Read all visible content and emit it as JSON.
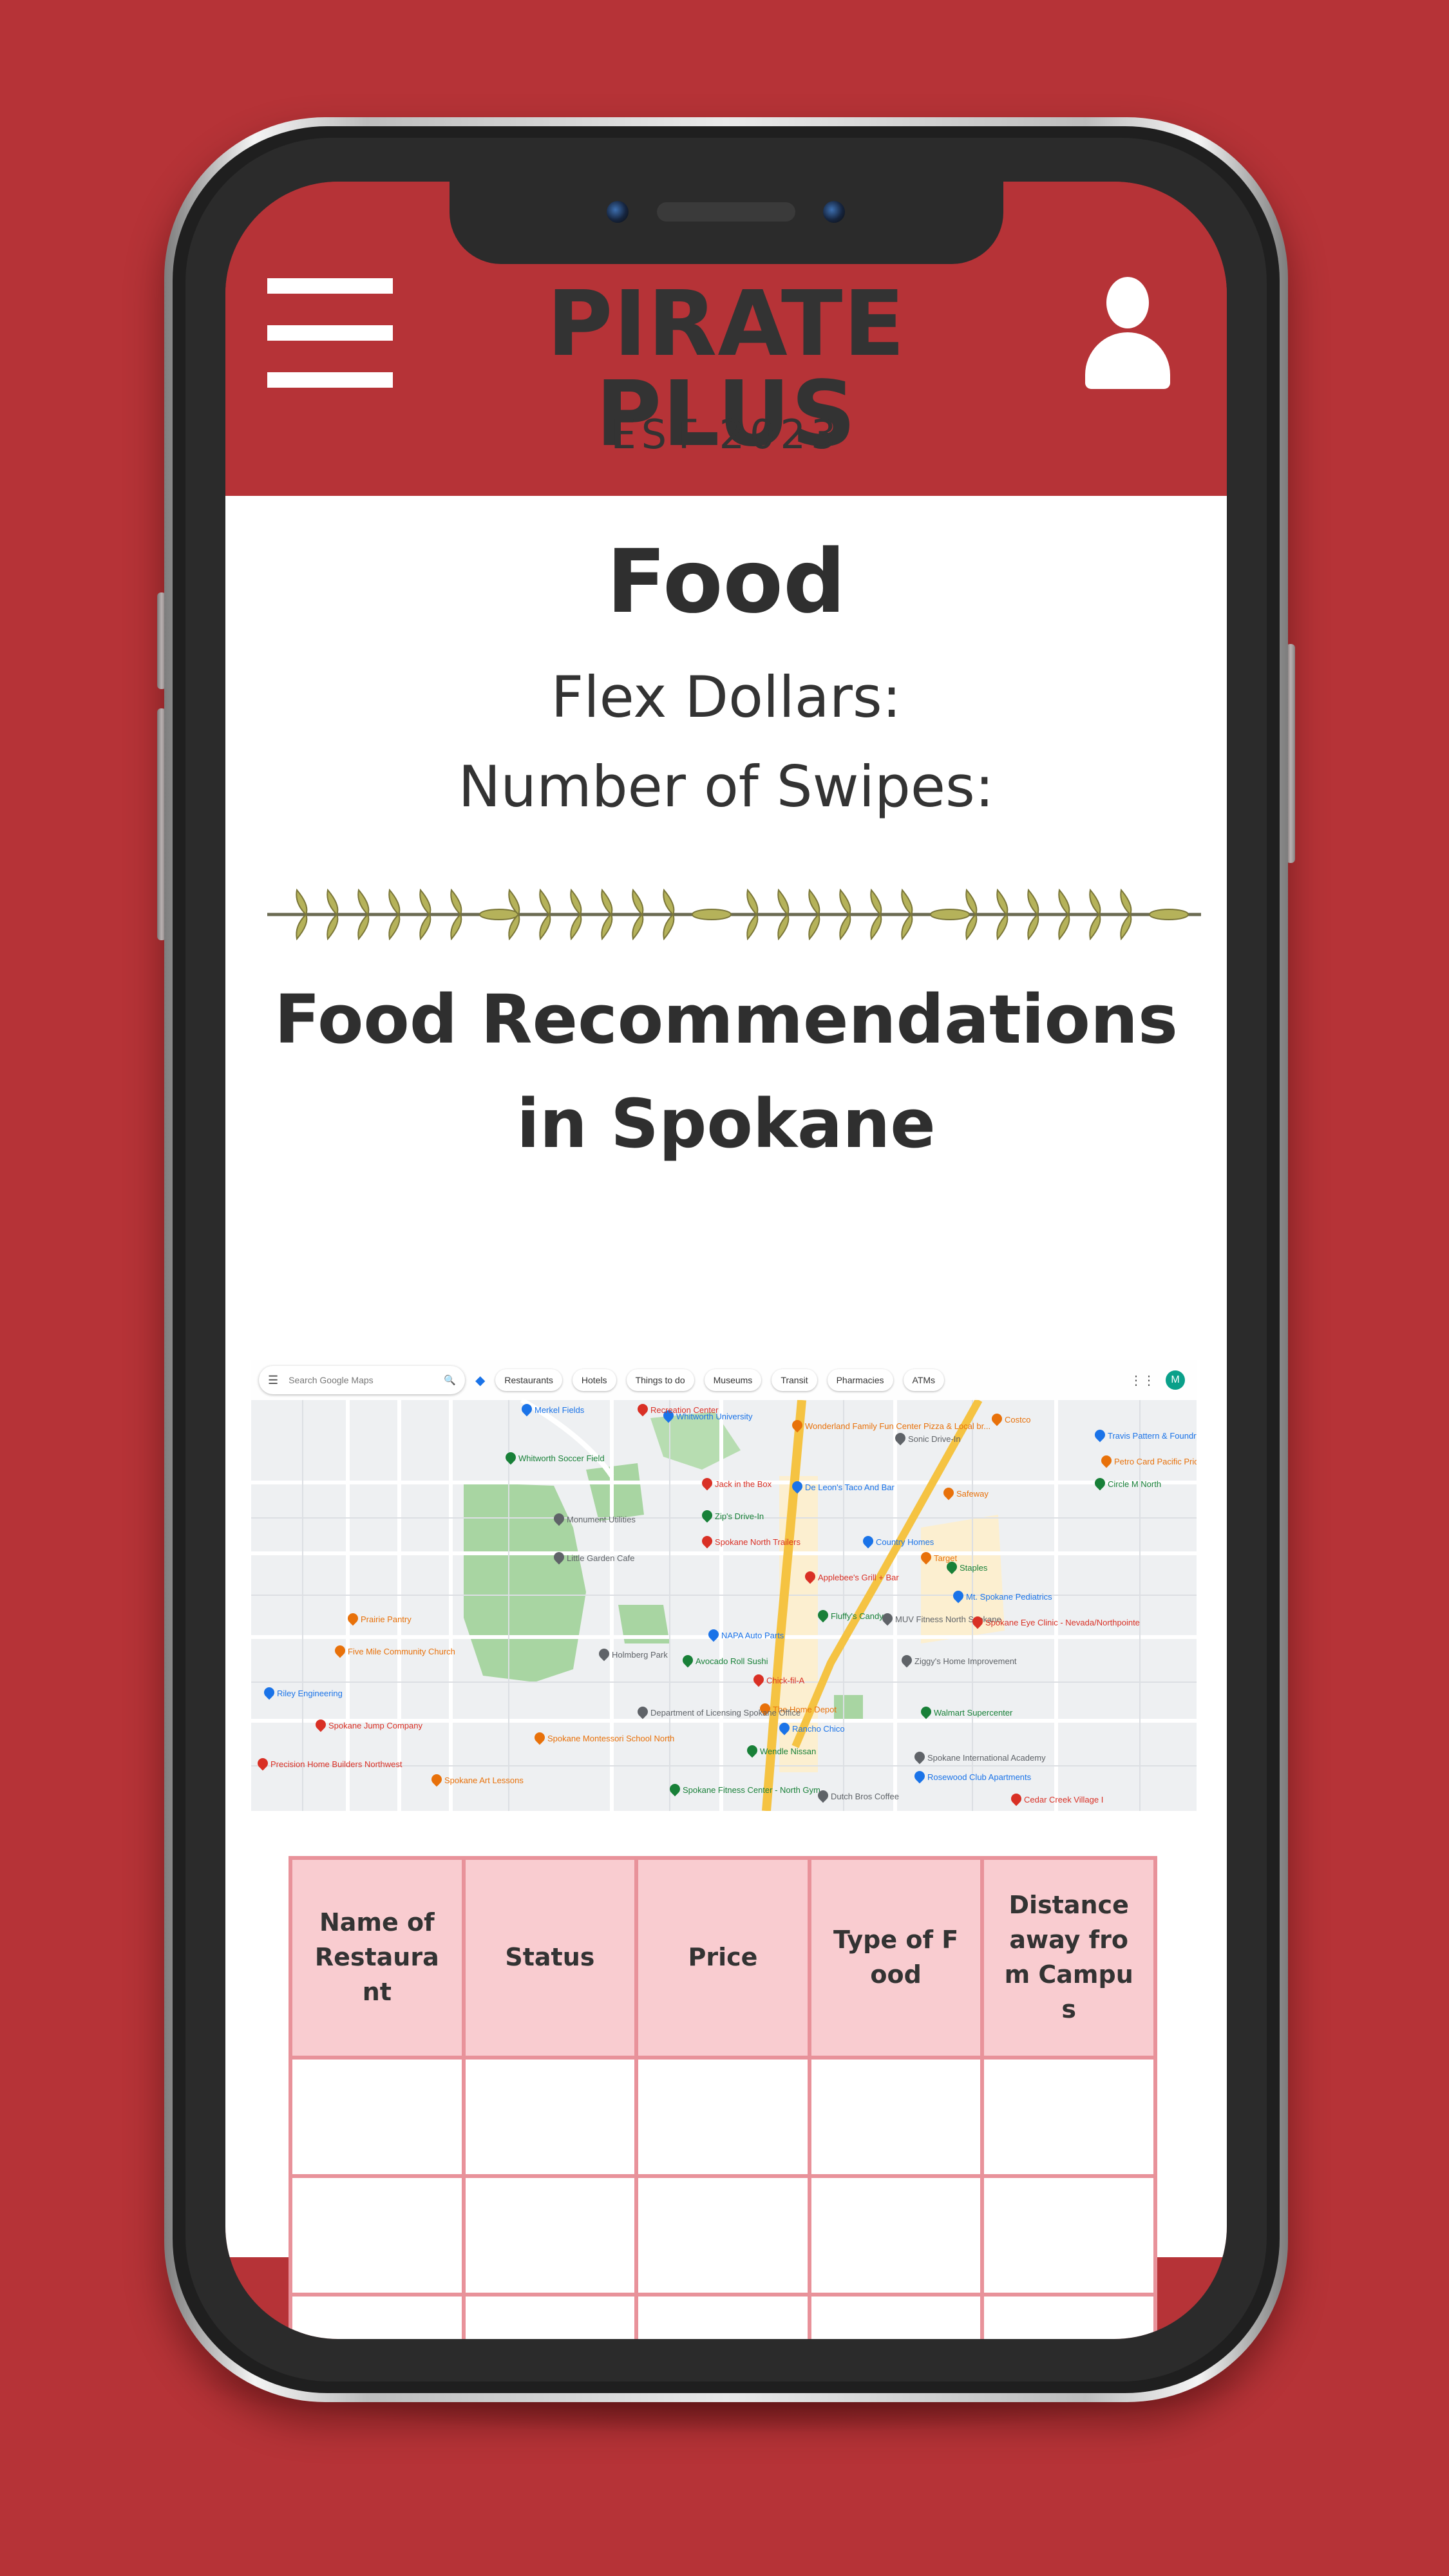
{
  "header": {
    "brand": "PIRATE PLUS",
    "tagline": "EST 2023"
  },
  "page": {
    "title": "Food",
    "flex_dollars_label": "Flex Dollars:",
    "swipes_label": "Number of Swipes:",
    "recommendations_title_line1": "Food Recommendations",
    "recommendations_title_line2": "in Spokane"
  },
  "map": {
    "search_placeholder": "Search Google Maps",
    "chips": [
      "Restaurants",
      "Hotels",
      "Things to do",
      "Museums",
      "Transit",
      "Pharmacies",
      "ATMs"
    ],
    "places": [
      "Whitworth University",
      "Wonderland Family Fun Center Pizza & Local br...",
      "Whitworth Soccer Field",
      "Sonic Drive-In",
      "Jack in the Box",
      "De Leon's Taco And Bar",
      "Safeway",
      "Zip's Drive-In",
      "Monument Utilities",
      "Spokane North Trailers",
      "Country Homes",
      "Target",
      "Staples",
      "Little Garden Cafe",
      "Applebee's Grill + Bar",
      "Mt. Spokane Pediatrics",
      "Prairie Pantry",
      "Fluffy's Candy",
      "MUV Fitness North Spokane",
      "Spokane Eye Clinic - Nevada/Northpointe",
      "NAPA Auto Parts",
      "Five Mile Community Church",
      "Avocado Roll Sushi",
      "Ziggy's Home Improvement",
      "Chick-fil-A",
      "Riley Engineering",
      "The Home Depot",
      "Walmart Supercenter",
      "Department of Licensing Spokane Office",
      "Spokane Jump Company",
      "Rancho Chico",
      "Spokane Montessori School North",
      "Wendle Nissan",
      "Spokane International Academy",
      "Precision Home Builders Northwest",
      "Rosewood Club Apartments",
      "Spokane Art Lessons",
      "Spokane Fitness Center - North Gym",
      "Dutch Bros Coffee",
      "Cedar Creek Village I",
      "Travis Pattern & Foundry",
      "Petro Card Pacific Pride",
      "Circle M North",
      "Holmberg Park",
      "Recreation Center",
      "Merkel Fields",
      "Costco"
    ],
    "colors": {
      "land": "#eef0f2",
      "park": "#a8d5a2",
      "highway": "#f5c342",
      "commercial": "#fcefd0"
    }
  },
  "table": {
    "headers": [
      "Name of Restaurant",
      "Status",
      "Price",
      "Type of Food",
      "Distance away from Campus"
    ],
    "rows": [
      [
        "",
        "",
        "",
        "",
        ""
      ],
      [
        "",
        "",
        "",
        "",
        ""
      ],
      [
        "",
        "",
        "",
        "",
        ""
      ]
    ]
  },
  "colors": {
    "brand_red": "#b63337",
    "text_dark": "#333333",
    "table_header_bg": "#f9ccd0",
    "table_border": "#e8929a",
    "laurel": "#b5b25a"
  },
  "icons": [
    "hamburger-menu-icon",
    "user-avatar-icon",
    "laurel-divider",
    "search-icon",
    "directions-icon",
    "apps-grid-icon"
  ]
}
